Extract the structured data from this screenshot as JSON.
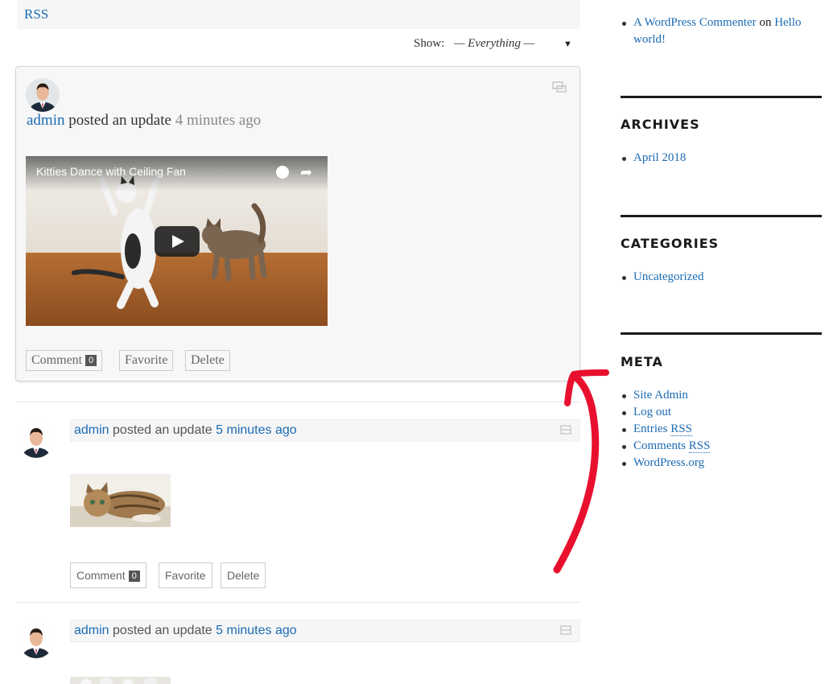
{
  "top": {
    "rss_label": "RSS"
  },
  "filter": {
    "label": "Show:",
    "value": "— Everything —",
    "arrow": "▼"
  },
  "activities": [
    {
      "user": "admin",
      "action": "posted an update",
      "time": "4 minutes ago",
      "video_title": "Kitties Dance with Ceiling Fan",
      "buttons": {
        "comment": "Comment",
        "comment_count": "0",
        "favorite": "Favorite",
        "delete": "Delete"
      }
    },
    {
      "user": "admin",
      "action": "posted an update",
      "time": "5 minutes ago",
      "buttons": {
        "comment": "Comment",
        "comment_count": "0",
        "favorite": "Favorite",
        "delete": "Delete"
      }
    },
    {
      "user": "admin",
      "action": "posted an update",
      "time": "5 minutes ago"
    }
  ],
  "sidebar": {
    "recent_comments": [
      {
        "author": "A WordPress Commenter",
        "on": "on",
        "post_line1": "Hello",
        "post_line2": "world!"
      }
    ],
    "archives": {
      "title": "ARCHIVES",
      "items": [
        "April 2018"
      ]
    },
    "categories": {
      "title": "CATEGORIES",
      "items": [
        "Uncategorized"
      ]
    },
    "meta": {
      "title": "META",
      "site_admin": "Site Admin",
      "log_out": "Log out",
      "entries_prefix": "Entries",
      "comments_prefix": "Comments",
      "rss": "RSS",
      "wordpress_org": "WordPress.org"
    }
  },
  "colors": {
    "link": "#1b6bb5",
    "annotation_arrow": "#e8102e"
  }
}
